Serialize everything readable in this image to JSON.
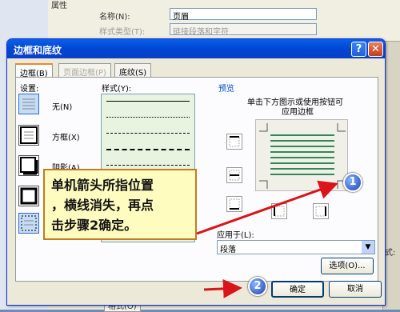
{
  "background": {
    "section_label": "属性",
    "name_label": "名称(N):",
    "name_value": "页眉",
    "style_type_label": "样式类型(T):",
    "style_type_value": "链接段落和字符",
    "format_label": "格式(O)",
    "right_label": "式:"
  },
  "dialog": {
    "title": "边框和底纹",
    "help_label": "?",
    "close_label": "✕",
    "tabs": [
      {
        "label": "边框(B)",
        "state": "active"
      },
      {
        "label": "页面边框(P)",
        "state": "disabled"
      },
      {
        "label": "底纹(S)",
        "state": "normal"
      }
    ],
    "setting_label": "设置:",
    "settings": [
      {
        "label": "无(N)"
      },
      {
        "label": "方框(X)"
      },
      {
        "label": "阴影(A)"
      }
    ],
    "style_label": "样式(Y):",
    "preview_label": "预览",
    "preview_hint_line1": "单击下方图示或使用按钮可",
    "preview_hint_line2": "应用边框",
    "apply_to_label": "应用于(L):",
    "apply_to_value": "段落",
    "options_button": "选项(O)...",
    "ok_button": "确定",
    "cancel_button": "取消"
  },
  "annotation": {
    "callout_text_line1": "单机箭头所指位置",
    "callout_text_line2": "，横线消失，再点",
    "callout_text_line3": "击步骤2确定。",
    "step1": "1",
    "step2": "2",
    "arrow_color": "#d9141a"
  },
  "colors": {
    "titlebar": "#0046d5",
    "preview_lines": "#2e8b57",
    "callout_bg": "#fffcc0"
  }
}
